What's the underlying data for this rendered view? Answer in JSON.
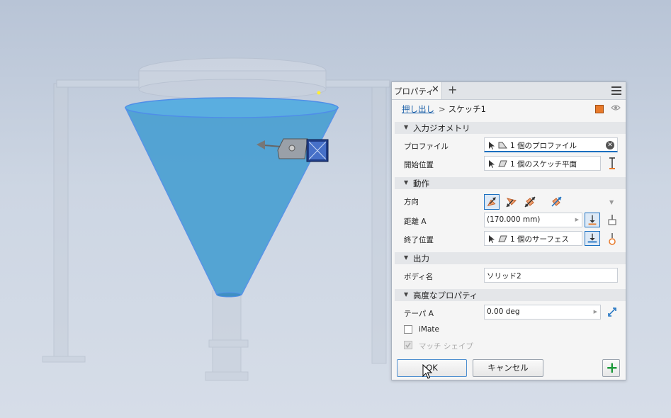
{
  "tab": {
    "label": "プロパティ",
    "close_glyph": "✕",
    "add_glyph": "+"
  },
  "breadcrumb": {
    "link": "押し出し",
    "separator": ">",
    "current": "スケッチ1"
  },
  "sections": {
    "input_geometry": "入力ジオメトリ",
    "behavior": "動作",
    "output": "出力",
    "advanced": "高度なプロパティ"
  },
  "input_geometry": {
    "profile_label": "プロファイル",
    "profile_value": "1 個のプロファイル",
    "start_label": "開始位置",
    "start_value": "1 個のスケッチ平面"
  },
  "behavior": {
    "direction_label": "方向",
    "distance_label": "距離 A",
    "distance_value": "(170.000 mm)",
    "end_label": "終了位置",
    "end_value": "1 個のサーフェス"
  },
  "output": {
    "body_label": "ボディ名",
    "body_value": "ソリッド2"
  },
  "advanced": {
    "taper_label": "テーパ A",
    "taper_value": "0.00 deg",
    "imate_label": "iMate",
    "match_shape_label": "マッチ シェイプ"
  },
  "buttons": {
    "ok": "OK",
    "cancel": "キャンセル"
  },
  "icons": {
    "menu": "hamburger-menu-icon",
    "solid": "solid-body-icon",
    "eye": "visibility-eye-icon",
    "plus": "green-plus-icon"
  },
  "colors": {
    "accent": "#1a6fc0",
    "cone_fill": "#4aa0d2",
    "cone_edge": "#4f8ee8",
    "add_green": "#1e9a3c",
    "link_blue": "#1a5fa8"
  }
}
